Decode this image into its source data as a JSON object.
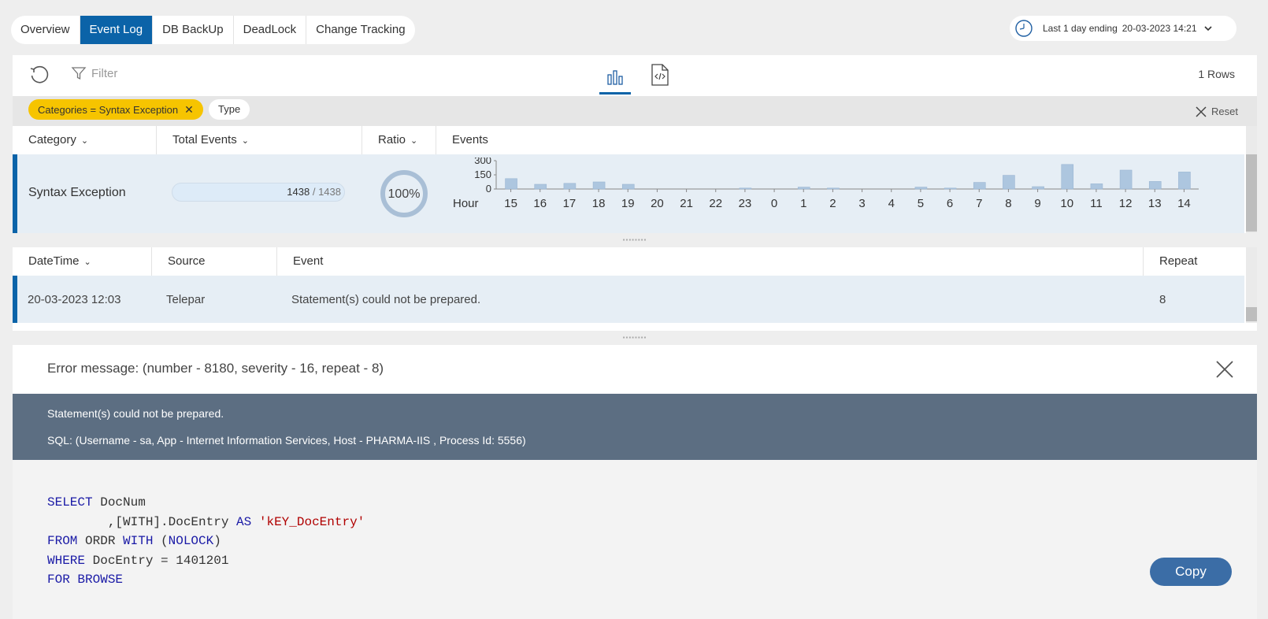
{
  "tabs": [
    {
      "label": "Overview",
      "active": false
    },
    {
      "label": "Event Log",
      "active": true
    },
    {
      "label": "DB BackUp",
      "active": false
    },
    {
      "label": "DeadLock",
      "active": false
    },
    {
      "label": "Change Tracking",
      "active": false
    }
  ],
  "timerange": {
    "label": "Last 1 day ending",
    "value": "20-03-2023 14:21"
  },
  "toolbar": {
    "filter_label": "Filter",
    "rows_count": "1 Rows"
  },
  "chips": {
    "category": "Categories = Syntax Exception",
    "type": "Type",
    "reset": "Reset"
  },
  "summary": {
    "headers": [
      "Category",
      "Total Events",
      "Ratio",
      "Events"
    ],
    "row": {
      "category": "Syntax Exception",
      "total": "1438",
      "of": "/ 1438",
      "ratio": "100%",
      "ratio_value": 1.0
    }
  },
  "chart_data": {
    "type": "bar",
    "categories": [
      "15",
      "16",
      "17",
      "18",
      "19",
      "20",
      "21",
      "22",
      "23",
      "0",
      "1",
      "2",
      "3",
      "4",
      "5",
      "6",
      "7",
      "8",
      "9",
      "10",
      "11",
      "12",
      "13",
      "14"
    ],
    "values": [
      110,
      50,
      60,
      75,
      50,
      0,
      0,
      0,
      10,
      0,
      20,
      10,
      0,
      0,
      20,
      10,
      70,
      145,
      25,
      260,
      55,
      200,
      80,
      180
    ],
    "xlabel": "Hour",
    "yticks": [
      "300",
      "150",
      "0"
    ],
    "ylim": [
      0,
      300
    ]
  },
  "details": {
    "headers": [
      "DateTime",
      "Source",
      "Event",
      "Repeat"
    ],
    "row": {
      "datetime": "20-03-2023 12:03",
      "source": "Telepar",
      "event": "Statement(s) could not be prepared.",
      "repeat": "8"
    }
  },
  "error": {
    "title": "Error message: (number - 8180, severity - 16, repeat - 8)",
    "line1": "Statement(s) could not be prepared.",
    "line2": "SQL: (Username - sa, App - Internet Information Services, Host -   PHARMA-IIS , Process Id: 5556)"
  },
  "sql": {
    "l1_kw": "SELECT",
    "l1_rest": " DocNum",
    "l2_rest": "        ,[WITH].DocEntry ",
    "l2_kw": "AS",
    "l2_str": "'kEY_DocEntry'",
    "l3_kw": "FROM",
    "l3_mid": " ORDR ",
    "l3_kw2": "WITH",
    "l3_p1": " (",
    "l3_kw3": "NOLOCK",
    "l3_p2": ")",
    "l4_kw": "WHERE",
    "l4_rest": " DocEntry = 1401201",
    "l5_kw": "FOR BROWSE"
  },
  "copy_label": "Copy"
}
